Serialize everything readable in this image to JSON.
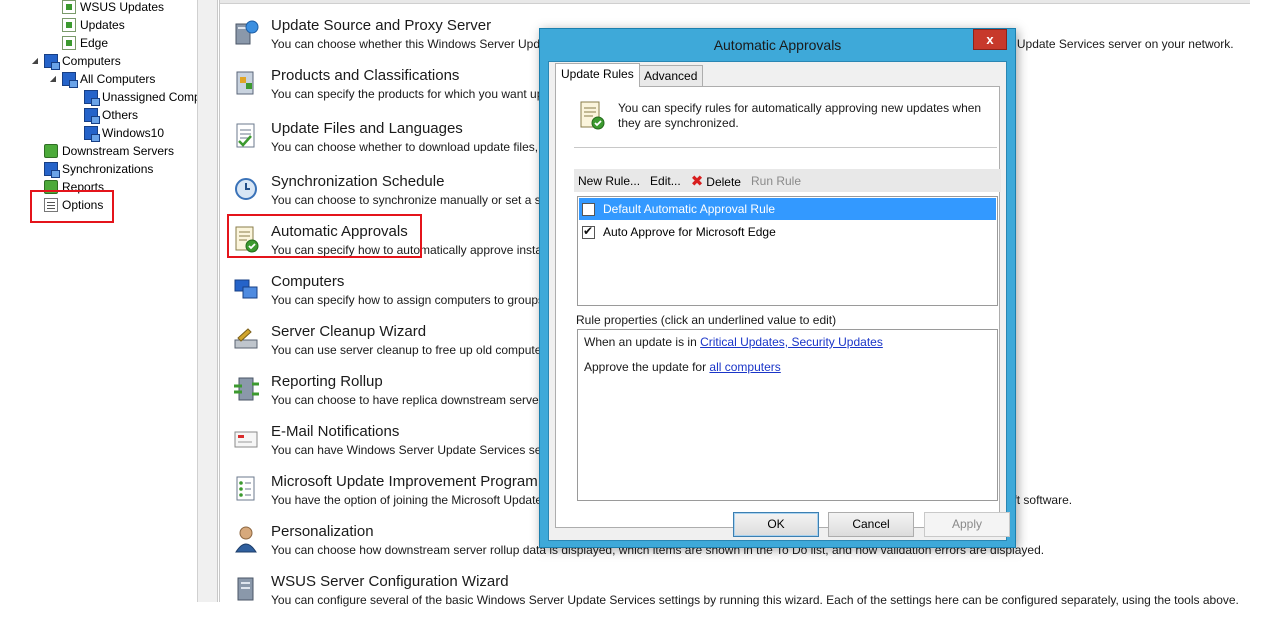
{
  "tree": {
    "items": [
      {
        "label": "WSUS Updates",
        "icon": "doc-icon"
      },
      {
        "label": "Updates",
        "icon": "doc-icon"
      },
      {
        "label": "Edge",
        "icon": "doc-icon"
      },
      {
        "label": "Computers",
        "icon": "computers-icon"
      },
      {
        "label": "All Computers",
        "icon": "computers-icon"
      },
      {
        "label": "Unassigned Comp",
        "icon": "computers-icon"
      },
      {
        "label": "Others",
        "icon": "computers-icon"
      },
      {
        "label": "Windows10",
        "icon": "computers-icon"
      },
      {
        "label": "Downstream Servers",
        "icon": "servers-icon"
      },
      {
        "label": "Synchronizations",
        "icon": "sync-icon"
      },
      {
        "label": "Reports",
        "icon": "reports-icon"
      },
      {
        "label": "Options",
        "icon": "options-icon"
      }
    ]
  },
  "options": [
    {
      "title": "Update Source and Proxy Server",
      "desc": "You can choose whether this Windows Server Update Services server synchronizes from Microsoft Update or from another Windows Server Update Services server on your network."
    },
    {
      "title": "Products and Classifications",
      "desc": "You can specify the products for which you want updates and the types of updates you want."
    },
    {
      "title": "Update Files and Languages",
      "desc": "You can choose whether to download update files, where to store update files, and which update languages you want to download."
    },
    {
      "title": "Synchronization Schedule",
      "desc": "You can choose to synchronize manually or set a schedule for daily automatic synchronization."
    },
    {
      "title": "Automatic Approvals",
      "desc": "You can specify how to automatically approve installation of updates for selected groups and how to approve revisions to existing updates."
    },
    {
      "title": "Computers",
      "desc": "You can specify how to assign computers to groups."
    },
    {
      "title": "Server Cleanup Wizard",
      "desc": "You can use server cleanup to free up old computers, updates and update files from your server."
    },
    {
      "title": "Reporting Rollup",
      "desc": "You can choose to have replica downstream servers roll up updates and computer status."
    },
    {
      "title": "E-Mail Notifications",
      "desc": "You can have Windows Server Update Services send e-mail notifications of new updates and status reports."
    },
    {
      "title": "Microsoft Update Improvement Program",
      "desc": "You have the option of joining the Microsoft Update Improvement Program to help improve the quality, reliability and performance of Microsoft software."
    },
    {
      "title": "Personalization",
      "desc": "You can choose how downstream server rollup data is displayed, which items are shown in the To Do list, and how validation errors are displayed."
    },
    {
      "title": "WSUS Server Configuration Wizard",
      "desc": "You can configure several of the basic Windows Server Update Services settings by running this wizard. Each of the settings here can be configured separately, using the tools above."
    }
  ],
  "dialog": {
    "title": "Automatic Approvals",
    "close_label": "x",
    "tabs": {
      "rules": "Update Rules",
      "advanced": "Advanced"
    },
    "intro": "You can specify rules for automatically approving new updates when they are synchronized.",
    "toolbar": {
      "new_rule": "New Rule...",
      "edit": "Edit...",
      "delete": "Delete",
      "run_rule": "Run Rule"
    },
    "rules": [
      {
        "label": "Default Automatic Approval Rule",
        "checked": false,
        "selected": true
      },
      {
        "label": "Auto Approve for Microsoft Edge",
        "checked": true,
        "selected": false
      }
    ],
    "props_label": "Rule properties (click an underlined value to edit)",
    "props": {
      "line1_prefix": "When an update is in ",
      "line1_link": "Critical Updates, Security Updates",
      "line2_prefix": "Approve the update for ",
      "line2_link": "all computers"
    },
    "buttons": {
      "ok": "OK",
      "cancel": "Cancel",
      "apply": "Apply"
    }
  }
}
